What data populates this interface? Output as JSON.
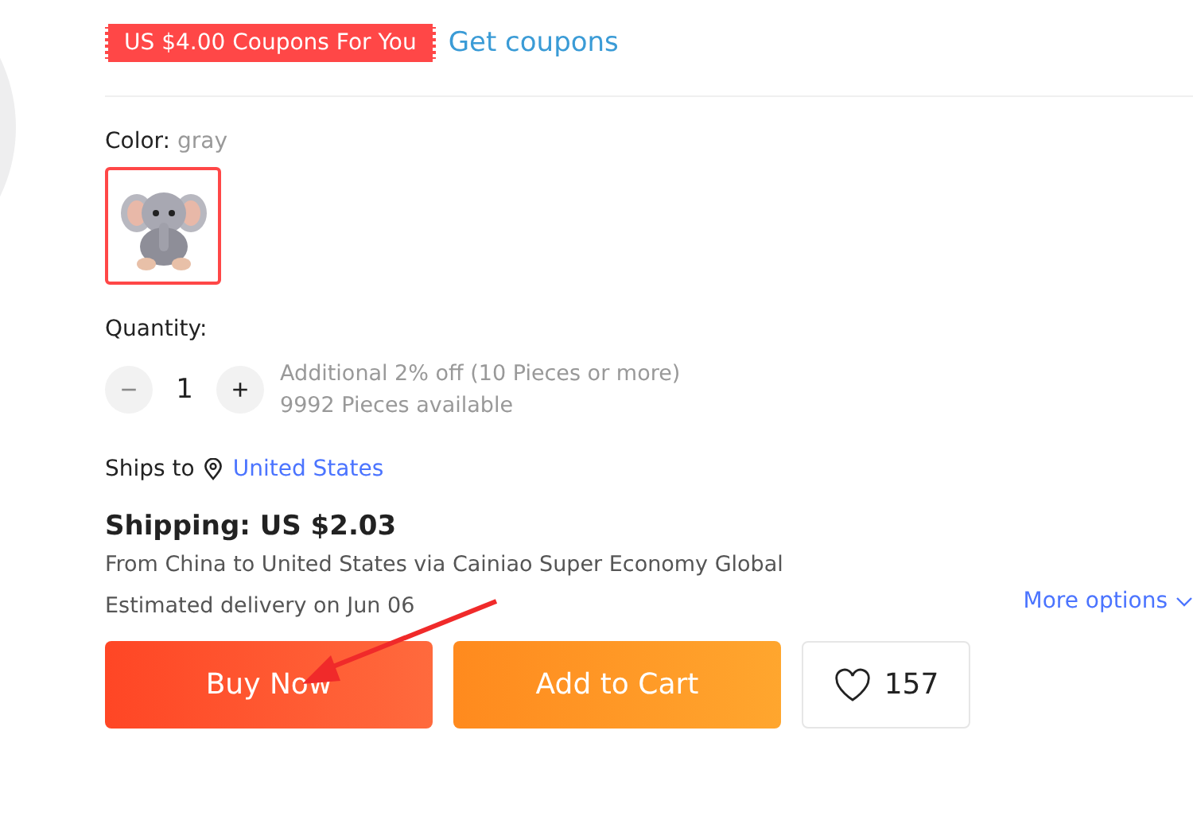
{
  "coupon": {
    "badge": "US $4.00 Coupons For You",
    "link": "Get coupons"
  },
  "color": {
    "label": "Color:",
    "value": "gray",
    "swatches": [
      {
        "selected": true
      }
    ]
  },
  "quantity": {
    "label": "Quantity:",
    "minus": "−",
    "value": "1",
    "plus": "+",
    "minus_disabled": true,
    "discount": "Additional 2% off (10 Pieces or more)",
    "available": "9992 Pieces available"
  },
  "ships_to": {
    "label": "Ships to",
    "country": "United States"
  },
  "shipping": {
    "title": "Shipping: US $2.03",
    "route": "From China to United States via Cainiao Super Economy Global",
    "delivery": "Estimated delivery on Jun 06",
    "more": "More options"
  },
  "buttons": {
    "buy": "Buy Now",
    "cart": "Add to Cart",
    "wishlist_count": "157"
  }
}
